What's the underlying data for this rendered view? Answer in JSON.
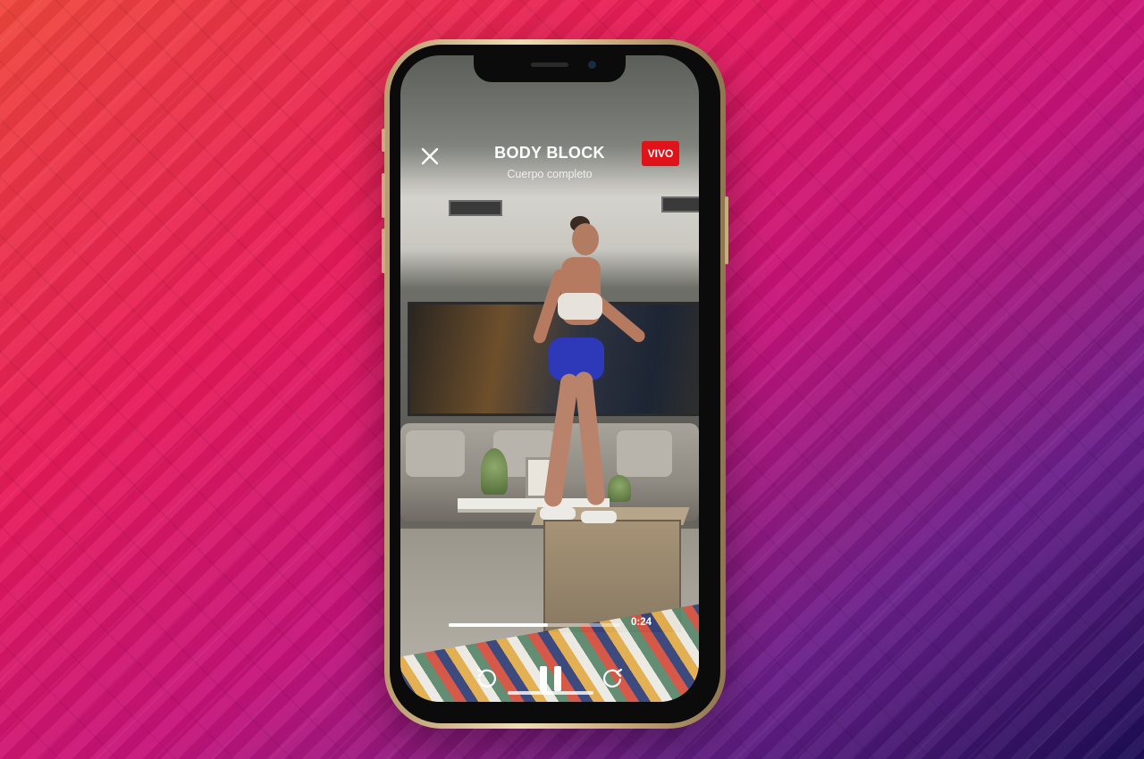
{
  "workout": {
    "title": "BODY BLOCK",
    "subtitle": "Cuerpo completo",
    "live_label": "VIVO"
  },
  "player": {
    "elapsed": "0:24",
    "progress": 0.58,
    "controls": {
      "rewind_icon": "rewind-icon",
      "pause_icon": "pause-icon",
      "forward_icon": "forward-icon"
    }
  },
  "colors": {
    "accent_live": "#e0131b",
    "text": "#ffffff"
  }
}
